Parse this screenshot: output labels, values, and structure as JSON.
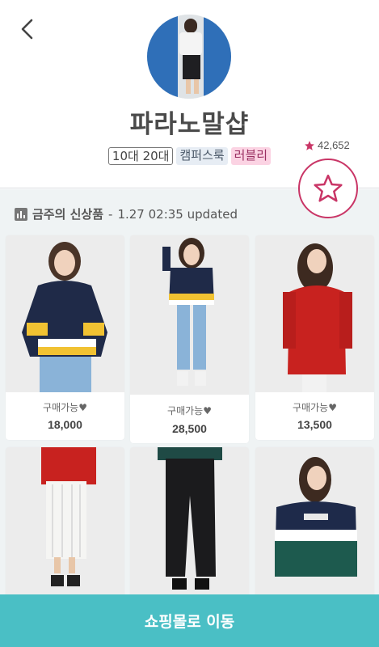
{
  "header": {
    "shop_name": "파라노말샵",
    "tags": [
      "10대 20대",
      "캠퍼스룩",
      "러블리"
    ],
    "rating": "42,652",
    "accent_color": "#c93566"
  },
  "update_bar": {
    "title": "금주의 신상품",
    "separator": "-",
    "time": "1.27 02:35 updated"
  },
  "products": [
    {
      "status": "구매가능♥",
      "price": "18,000"
    },
    {
      "status": "구매가능♥",
      "price": "28,500"
    },
    {
      "status": "구매가능♥",
      "price": "13,500"
    },
    {
      "status": "",
      "price": ""
    },
    {
      "status": "",
      "price": ""
    },
    {
      "status": "",
      "price": ""
    }
  ],
  "cta": {
    "label": "쇼핑몰로 이동",
    "color": "#4abfc5"
  }
}
